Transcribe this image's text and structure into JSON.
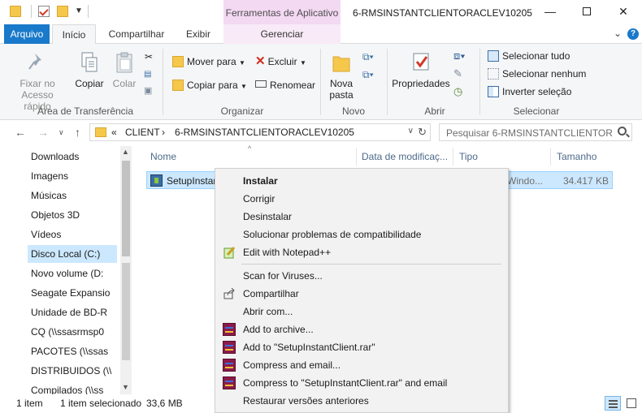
{
  "window": {
    "title": "6-RMSINSTANTCLIENTORACLEV10205",
    "context_tab_header": "Ferramentas de Aplicativo",
    "minimize_glyph": "—",
    "close_glyph": "✕"
  },
  "ribbon_tabs": {
    "arquivo": "Arquivo",
    "inicio": "Início",
    "compartilhar": "Compartilhar",
    "exibir": "Exibir",
    "gerenciar": "Gerenciar"
  },
  "ribbon": {
    "fixar": "Fixar no Acesso rápido",
    "fixar_line1": "Fixar no",
    "fixar_line2": "Acesso rápido",
    "copiar": "Copiar",
    "colar": "Colar",
    "group_area": "Área de Transferência",
    "mover_para": "Mover para",
    "copiar_para": "Copiar para",
    "excluir": "Excluir",
    "renomear": "Renomear",
    "group_organizar": "Organizar",
    "nova_pasta_line1": "Nova",
    "nova_pasta_line2": "pasta",
    "group_novo": "Novo",
    "propriedades": "Propriedades",
    "group_abrir": "Abrir",
    "selecionar_tudo": "Selecionar tudo",
    "selecionar_nenhum": "Selecionar nenhum",
    "inverter_selecao": "Inverter seleção",
    "group_selecionar": "Selecionar"
  },
  "address": {
    "prefix": "«",
    "crumb1": "CLIENT",
    "separator": "›",
    "crumb2": "6-RMSINSTANTCLIENTORACLEV10205",
    "search_placeholder": "Pesquisar 6-RMSINSTANTCLIENTOR..."
  },
  "nav_pane": {
    "items": [
      {
        "label": "Downloads",
        "icon": "download-arrow-icon"
      },
      {
        "label": "Imagens",
        "icon": "pictures-icon"
      },
      {
        "label": "Músicas",
        "icon": "music-note-icon"
      },
      {
        "label": "Objetos 3D",
        "icon": "cube-3d-icon"
      },
      {
        "label": "Vídeos",
        "icon": "film-strip-icon"
      },
      {
        "label": "Disco Local (C:)",
        "icon": "local-disk-icon"
      },
      {
        "label": "Novo volume (D:",
        "icon": "drive-icon"
      },
      {
        "label": "Seagate Expansio",
        "icon": "external-drive-icon"
      },
      {
        "label": "Unidade de BD-R",
        "icon": "optical-drive-icon"
      },
      {
        "label": "CQ (\\\\ssasrmsp0",
        "icon": "network-drive-disconnected-icon"
      },
      {
        "label": "PACOTES (\\\\ssas",
        "icon": "network-drive-disconnected-icon"
      },
      {
        "label": "DISTRIBUIDOS (\\\\",
        "icon": "network-drive-disconnected-icon"
      },
      {
        "label": "Compilados (\\\\ss",
        "icon": "network-drive-disconnected-icon"
      }
    ]
  },
  "file_list": {
    "columns": {
      "name": "Nome",
      "date": "Data de modificaç...",
      "type": "Tipo",
      "size": "Tamanho"
    },
    "files": [
      {
        "name": "SetupInstantClient",
        "name_visible": "SetupInstar",
        "type": "Windo...",
        "size": "34.417 KB"
      }
    ]
  },
  "status": {
    "count": "1 item",
    "selected": "1 item selecionado",
    "size": "33,6 MB"
  },
  "context_menu": {
    "items": [
      {
        "label": "Instalar",
        "bold": true,
        "icon": ""
      },
      {
        "label": "Corrigir",
        "icon": ""
      },
      {
        "label": "Desinstalar",
        "icon": ""
      },
      {
        "label": "Solucionar problemas de compatibilidade",
        "icon": ""
      },
      {
        "label": "Edit with Notepad++",
        "icon": "notepad-plus-plus-icon"
      },
      {
        "label": "Scan for Viruses...",
        "icon": ""
      },
      {
        "label": "Compartilhar",
        "icon": "share-icon"
      },
      {
        "label": "Abrir com...",
        "icon": ""
      },
      {
        "label": "Add to archive...",
        "icon": "winrar-icon"
      },
      {
        "label": "Add to \"SetupInstantClient.rar\"",
        "icon": "winrar-icon"
      },
      {
        "label": "Compress and email...",
        "icon": "winrar-icon"
      },
      {
        "label": "Compress to \"SetupInstantClient.rar\" and email",
        "icon": "winrar-icon"
      },
      {
        "label": "Restaurar versões anteriores",
        "icon": ""
      }
    ]
  },
  "colors": {
    "accent": "#1979ca",
    "context_tab": "#f4d9f3",
    "selection": "#cce8ff",
    "folder": "#f5c84c"
  }
}
